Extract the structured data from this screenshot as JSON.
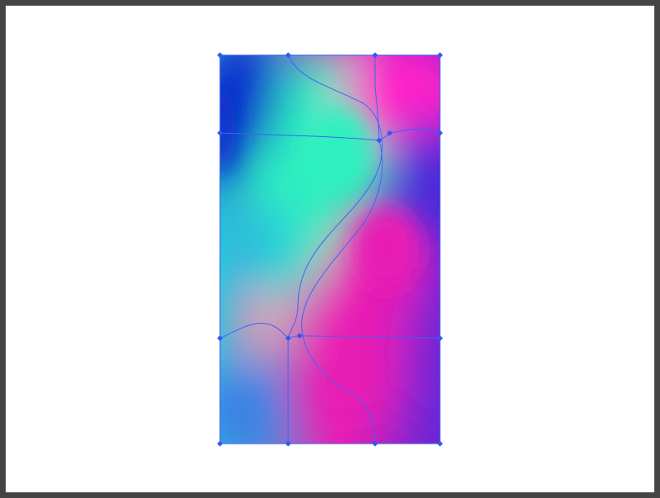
{
  "colors": {
    "frame": "#444444",
    "canvas": "#ffffff",
    "mesh_line": "#3d63f2",
    "anchor": "#3158ee",
    "teal": "#2df0c0",
    "cyan": "#25c4dc",
    "deep_blue": "#0a2fcc",
    "magenta": "#ff22c8",
    "hot_pink": "#e81fb4",
    "violet": "#6a25d6",
    "indigo": "#4a2ad8",
    "peach": "#e8a3b6",
    "sky_blue": "#3b7fe6"
  },
  "gradient_mesh": {
    "rows": 4,
    "columns": 4
  }
}
